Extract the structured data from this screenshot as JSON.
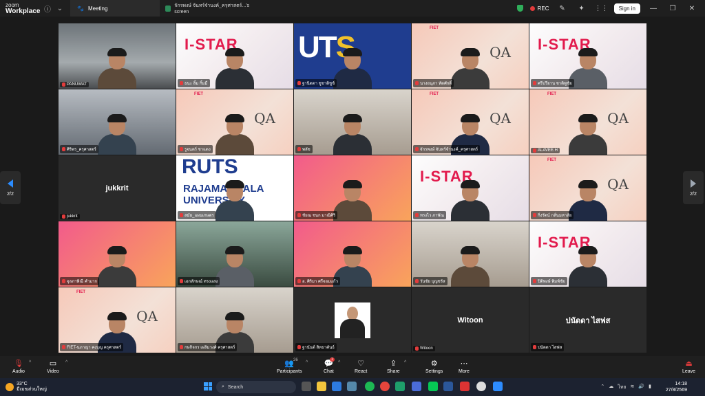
{
  "app": {
    "brand_line1": "zoom",
    "brand_line2": "Workplace",
    "meeting_tab": "Meeting",
    "share_tab": "จักรพงษ์ จันทร์จำนงค์_ครุศาสตร์...'s screen",
    "rec_label": "REC",
    "signin_label": "Sign in"
  },
  "pager": {
    "left": "2/2",
    "right": "2/2"
  },
  "tiles": [
    {
      "name": "PANUWAT",
      "bg": "office"
    },
    {
      "name": "ธนะ ลิ้ม กิ้มมี่",
      "bg": "istar"
    },
    {
      "name": "ฐานิดดา ชูชาติชูช์",
      "bg": "uts"
    },
    {
      "name": "นางอนุภา ทัตศักดิ์",
      "bg": "fiet"
    },
    {
      "name": "ศรีปรียาน ชาติพูชัย",
      "bg": "istar"
    },
    {
      "name": "ศิริพร_ครุศาสตร์",
      "bg": "lib"
    },
    {
      "name": "รูจนตร์ ชาแดง",
      "bg": "fiet"
    },
    {
      "name": "พลัช",
      "bg": "room"
    },
    {
      "name": "จักรพงษ์ จันทร์จำนงค์_ครุศาสตร์",
      "bg": "fiet"
    },
    {
      "name": "ALAVEE.H",
      "bg": "fiet"
    },
    {
      "name": "jukkrit",
      "bg": "dark",
      "center": "jukkrit"
    },
    {
      "name": "สมัย_แผนเกษตร",
      "bg": "rut"
    },
    {
      "name": "ชัยณ ชนก มาณิศิริ",
      "bg": "pink"
    },
    {
      "name": "ทรงไว ภาพัณ",
      "bg": "istar"
    },
    {
      "name": "กิ่งรัตน์ กลั่นมหาลัย",
      "bg": "fiet"
    },
    {
      "name": "จุลภาพิณี คำมาก",
      "bg": "pink"
    },
    {
      "name": "เอกลักษณ์ ทรงแสง",
      "bg": "green"
    },
    {
      "name": "อ. ศิริมา ศรีจอมแก้ว",
      "bg": "pink"
    },
    {
      "name": "วันชัย บุญชรัส",
      "bg": "room"
    },
    {
      "name": "ปิติพงษ์ พิมพ์ชัย",
      "bg": "istar"
    },
    {
      "name": "FIET-นภาญา คงบุญ ครุศาสตร์",
      "bg": "fiet"
    },
    {
      "name": "กษกิจกร เผลิมวงศ์ ครุศาสตร์",
      "bg": "room"
    },
    {
      "name": "ฐานันต์ สิทธาคันธ์",
      "bg": "dark",
      "avatar": true
    },
    {
      "name": "Witoon",
      "bg": "dark",
      "center": "Witoon"
    },
    {
      "name": "ปนัดดา ไสฟส",
      "bg": "dark",
      "center": "ปนัดดา ไสฟส"
    }
  ],
  "toolbar": {
    "audio": "Audio",
    "video": "Video",
    "participants": "Participants",
    "participants_count": "26",
    "chat": "Chat",
    "chat_badge": "1",
    "react": "React",
    "share": "Share",
    "settings": "Settings",
    "more": "More",
    "leave": "Leave"
  },
  "taskbar": {
    "temp": "33°C",
    "weather_text": "มีเมฆส่วนใหญ่",
    "search_placeholder": "Search",
    "lang": "ไทย",
    "time": "14:18",
    "date": "27/8/2569"
  },
  "colors": {
    "accent": "#2b8cff",
    "rec": "#e13b3b",
    "active_speaker": "#3fce6b"
  }
}
